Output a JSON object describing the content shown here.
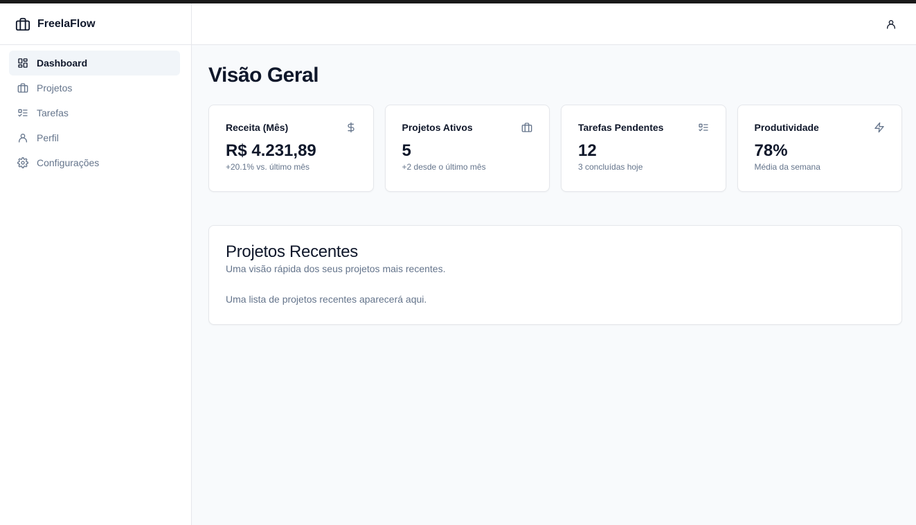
{
  "app": {
    "name": "FreelaFlow"
  },
  "sidebar": {
    "items": [
      {
        "label": "Dashboard",
        "icon": "dashboard-icon",
        "active": true
      },
      {
        "label": "Projetos",
        "icon": "briefcase-icon",
        "active": false
      },
      {
        "label": "Tarefas",
        "icon": "list-checks-icon",
        "active": false
      },
      {
        "label": "Perfil",
        "icon": "user-icon",
        "active": false
      },
      {
        "label": "Configurações",
        "icon": "gear-icon",
        "active": false
      }
    ]
  },
  "header": {
    "user_icon": "user-icon"
  },
  "main": {
    "title": "Visão Geral",
    "stats": [
      {
        "label": "Receita (Mês)",
        "value": "R$ 4.231,89",
        "sub": "+20.1% vs. último mês",
        "icon": "dollar-icon"
      },
      {
        "label": "Projetos Ativos",
        "value": "5",
        "sub": "+2 desde o último mês",
        "icon": "briefcase-icon"
      },
      {
        "label": "Tarefas Pendentes",
        "value": "12",
        "sub": "3 concluídas hoje",
        "icon": "list-checks-icon"
      },
      {
        "label": "Produtividade",
        "value": "78%",
        "sub": "Média da semana",
        "icon": "zap-icon"
      }
    ],
    "recent": {
      "title": "Projetos Recentes",
      "description": "Uma visão rápida dos seus projetos mais recentes.",
      "empty": "Uma lista de projetos recentes aparecerá aqui."
    }
  },
  "colors": {
    "text": "#0f172a",
    "muted": "#64748b",
    "border": "#e5e7eb",
    "active_bg": "#f1f5f9",
    "page_bg": "#f8fafc"
  }
}
